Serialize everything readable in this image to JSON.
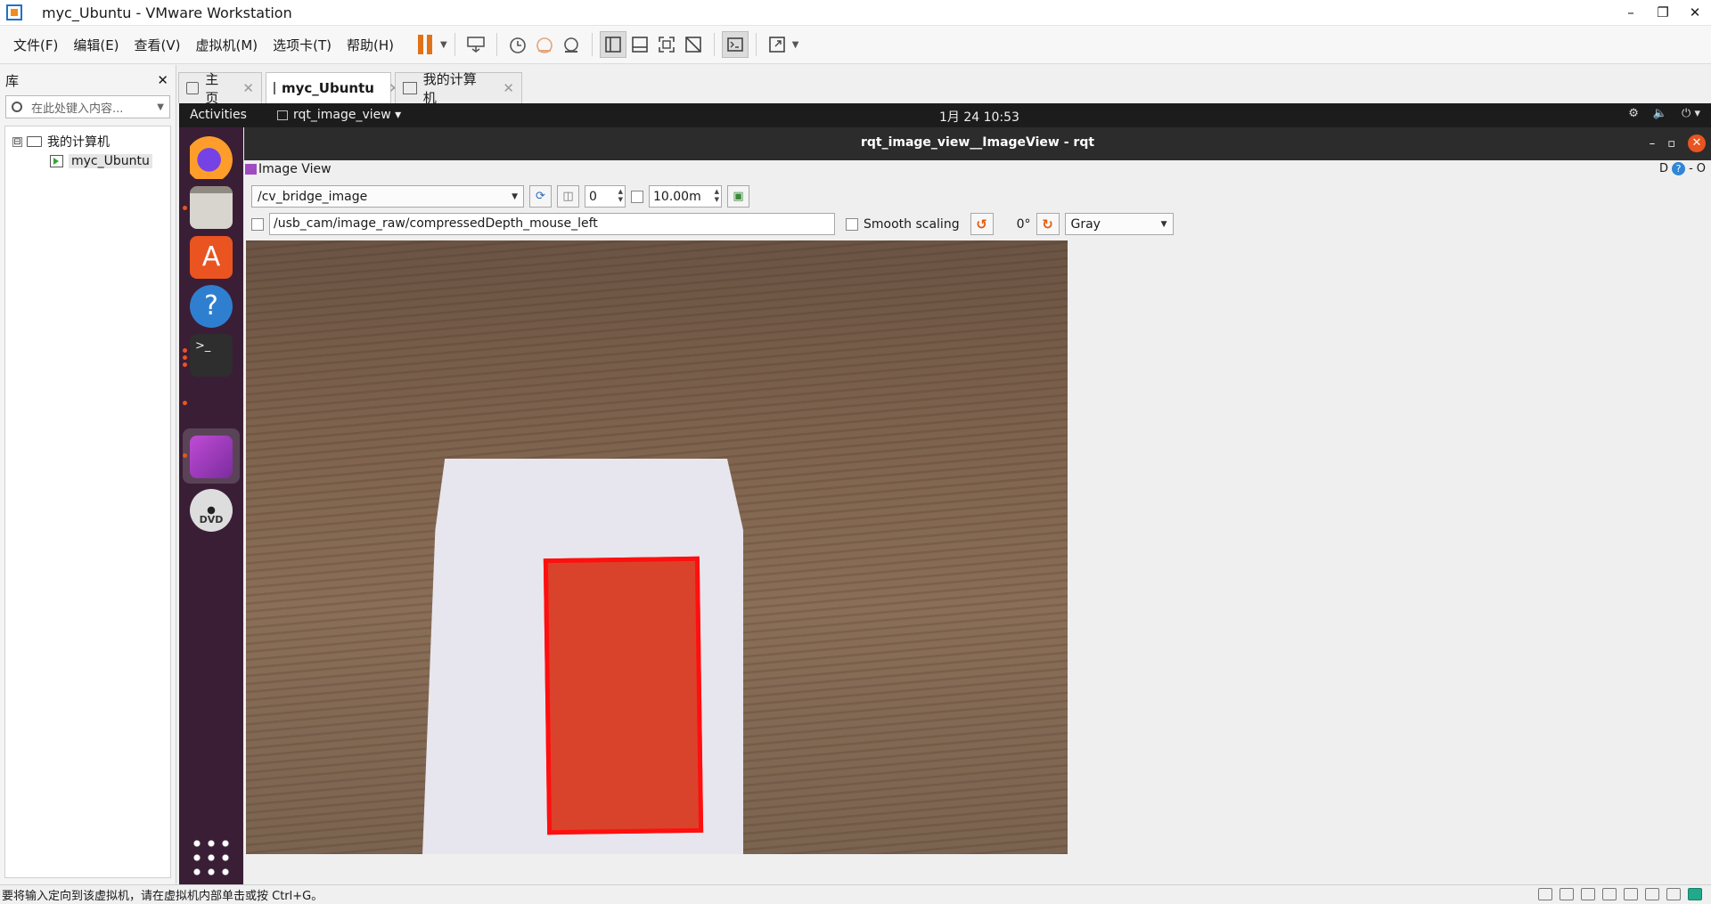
{
  "window": {
    "title": "myc_Ubuntu - VMware Workstation",
    "minimize": "–",
    "restore": "❐",
    "close": "✕"
  },
  "menubar": {
    "items": [
      "文件(F)",
      "编辑(E)",
      "查看(V)",
      "虚拟机(M)",
      "选项卡(T)",
      "帮助(H)"
    ]
  },
  "toolbar_icons": [
    "pause-icon",
    "send-ctrl-alt-del-icon",
    "snapshot-icon",
    "revert-snapshot-icon",
    "snapshot-manager-icon",
    "library-view-icon",
    "thumbnail-view-icon",
    "full-screen-icon",
    "unity-icon",
    "console-icon",
    "stretch-icon"
  ],
  "library": {
    "title": "库",
    "close": "✕",
    "search_placeholder": "在此处键入内容...",
    "tree": {
      "root": "我的计算机",
      "expander": "⊟",
      "child": "myc_Ubuntu"
    }
  },
  "tabs": [
    {
      "label": "主页",
      "close": "✕"
    },
    {
      "label": "myc_Ubuntu",
      "close": "✕"
    },
    {
      "label": "我的计算机",
      "close": "✕"
    }
  ],
  "ubuntu": {
    "activities": "Activities",
    "app_menu": "rqt_image_view ▾",
    "clock": "1月 24  10:53",
    "tray": [
      "⚙",
      "🔈",
      "⏻ ▾"
    ],
    "dock": [
      "firefox-icon",
      "files-icon",
      "software-icon",
      "help-icon",
      "terminal-icon",
      "image-viewer-icon",
      "dvd-icon",
      "show-apps-icon"
    ],
    "dock_labels": {
      "help": "?",
      "terminal": ">_",
      "dvd": "DVD"
    }
  },
  "rqt": {
    "window_title": "rqt_image_view__ImageView - rqt",
    "window_controls": [
      "–",
      "▫",
      "✕"
    ],
    "plugin_title": "Image View",
    "plugin_controls": {
      "d": "D",
      "help": "?",
      "dash": "-",
      "o": "O"
    },
    "topic": "/cv_bridge_image",
    "spin_value": "0",
    "max_range": "10.00m",
    "mouse_topic": "/usb_cam/image_raw/compressedDepth_mouse_left",
    "smooth_scaling": "Smooth scaling",
    "rotation": "0°",
    "color_scheme": "Gray"
  },
  "statusbar": {
    "message": "要将输入定向到该虚拟机，请在虚拟机内部单击或按 Ctrl+G。"
  },
  "colors": {
    "ubuntu_orange": "#e95420",
    "dock_bg": "#3a1e36",
    "detected_box": "#ff0f0f"
  }
}
